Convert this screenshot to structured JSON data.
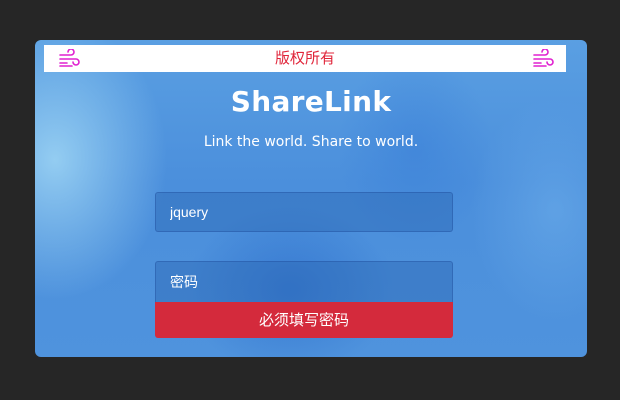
{
  "header": {
    "title": "版权所有",
    "left_icon": "wind-icon",
    "right_icon": "wind-icon",
    "icon_color": "#e020d0",
    "title_color": "#e0253a"
  },
  "main": {
    "brand": "ShareLink",
    "tagline": "Link the world. Share to world."
  },
  "form": {
    "username_value": "jquery",
    "password_placeholder": "密码",
    "error_message": "必须填写密码",
    "error_color": "#d42a3c"
  }
}
